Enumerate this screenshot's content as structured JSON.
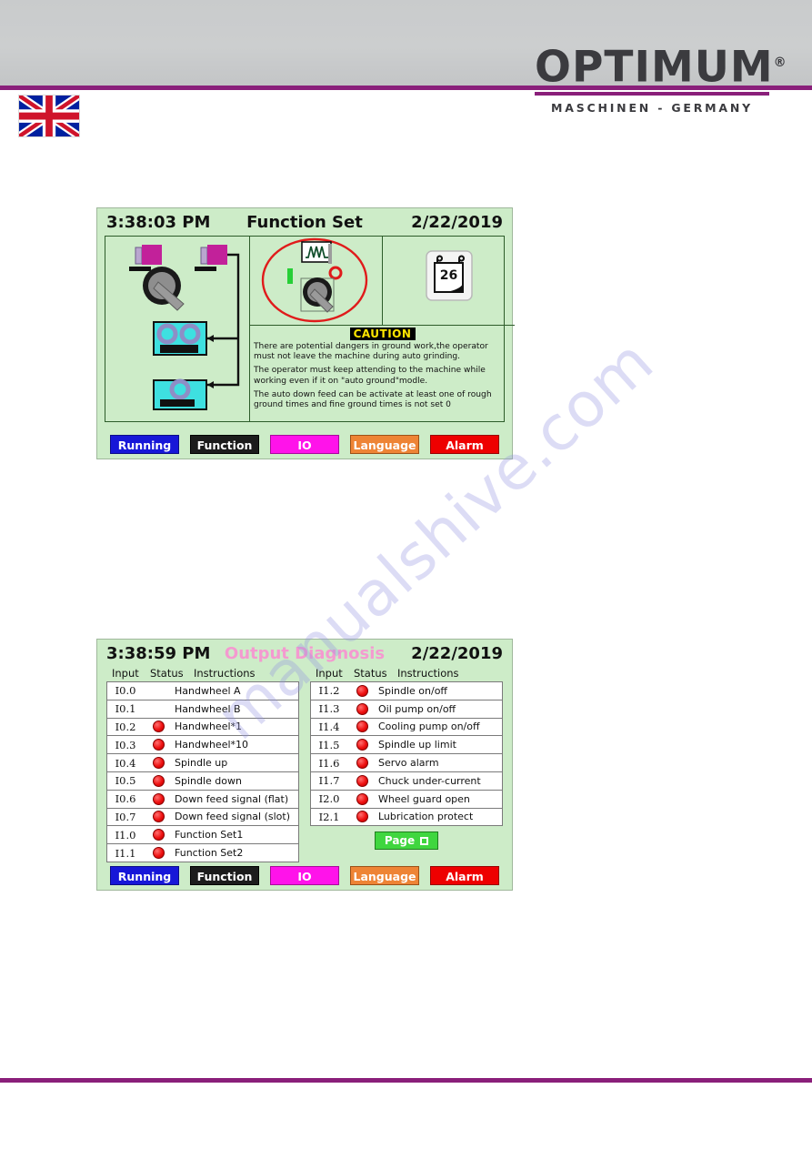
{
  "header": {
    "logo_word": "OPTIMUM",
    "logo_registered": "®",
    "logo_subtitle": "MASCHINEN - GERMANY",
    "flag_name": "uk-flag"
  },
  "watermark": {
    "text": "manualshive.com"
  },
  "panels": [
    {
      "id": "function-set",
      "time": "3:38:03 PM",
      "title": "Function Set",
      "date": "2/22/2019",
      "title_color": "#111111",
      "calendar_day": "26",
      "caution": {
        "badge": "CAUTION",
        "paragraphs": [
          "There are potential dangers in ground work,the operator  must  not leave the machine during auto grinding.",
          "The operator must keep attending to the machine while working even if it on \"auto ground\"modle.",
          "The auto down feed can be activate at least one of  rough ground times and fine ground times is not set 0"
        ]
      },
      "buttons": [
        {
          "label": "Running",
          "class": "btn-running"
        },
        {
          "label": "Function",
          "class": "btn-function"
        },
        {
          "label": "IO",
          "class": "btn-io"
        },
        {
          "label": "Language",
          "class": "btn-language"
        },
        {
          "label": "Alarm",
          "class": "btn-alarm"
        }
      ]
    },
    {
      "id": "output-diagnosis",
      "time": "3:38:59 PM",
      "title": "Output Diagnosis",
      "date": "2/22/2019",
      "title_color": "#f49ad0",
      "columns": {
        "input": "Input",
        "status": "Status",
        "instructions": "Instructions"
      },
      "left_rows": [
        {
          "addr": "I0.0",
          "lamp": false,
          "instr": "Handwheel A"
        },
        {
          "addr": "I0.1",
          "lamp": false,
          "instr": "Handwheel B"
        },
        {
          "addr": "I0.2",
          "lamp": true,
          "instr": "Handwheel*1"
        },
        {
          "addr": "I0.3",
          "lamp": true,
          "instr": "Handwheel*10"
        },
        {
          "addr": "I0.4",
          "lamp": true,
          "instr": "Spindle up"
        },
        {
          "addr": "I0.5",
          "lamp": true,
          "instr": "Spindle down"
        },
        {
          "addr": "I0.6",
          "lamp": true,
          "instr": "Down feed signal (flat)"
        },
        {
          "addr": "I0.7",
          "lamp": true,
          "instr": "Down feed signal (slot)"
        },
        {
          "addr": "I1.0",
          "lamp": true,
          "instr": "Function Set1"
        },
        {
          "addr": "I1.1",
          "lamp": true,
          "instr": "Function Set2"
        }
      ],
      "right_rows": [
        {
          "addr": "I1.2",
          "lamp": true,
          "instr": "Spindle on/off"
        },
        {
          "addr": "I1.3",
          "lamp": true,
          "instr": "Oil pump on/off"
        },
        {
          "addr": "I1.4",
          "lamp": true,
          "instr": "Cooling pump on/off"
        },
        {
          "addr": "I1.5",
          "lamp": true,
          "instr": "Spindle up limit"
        },
        {
          "addr": "I1.6",
          "lamp": true,
          "instr": "Servo alarm"
        },
        {
          "addr": "I1.7",
          "lamp": true,
          "instr": "Chuck under-current"
        },
        {
          "addr": "I2.0",
          "lamp": true,
          "instr": "Wheel guard open"
        },
        {
          "addr": "I2.1",
          "lamp": true,
          "instr": "Lubrication protect"
        }
      ],
      "page_button": {
        "label": "Page"
      },
      "buttons": [
        {
          "label": "Running",
          "class": "btn-running"
        },
        {
          "label": "Function",
          "class": "btn-function"
        },
        {
          "label": "IO",
          "class": "btn-io"
        },
        {
          "label": "Language",
          "class": "btn-language"
        },
        {
          "label": "Alarm",
          "class": "btn-alarm"
        }
      ]
    }
  ],
  "colors": {
    "screen_bg": "#cdecc8",
    "accent_purple": "#8a1f7a",
    "lamp_red": "#ee1010",
    "highlight_red": "#e01b1b",
    "magenta_part": "#c2219a",
    "cyan_block": "#3ee0e0"
  }
}
